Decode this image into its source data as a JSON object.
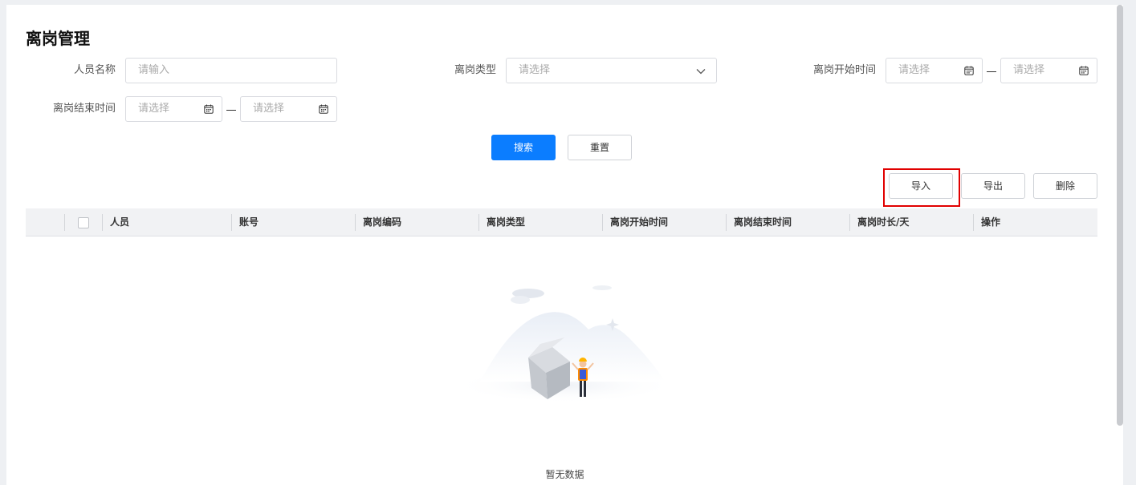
{
  "page": {
    "title": "离岗管理"
  },
  "filters": {
    "name_label": "人员名称",
    "name_placeholder": "请输入",
    "type_label": "离岗类型",
    "type_placeholder": "请选择",
    "start_label": "离岗开始时间",
    "start_from_placeholder": "请选择",
    "start_to_placeholder": "请选择",
    "end_label": "离岗结束时间",
    "end_from_placeholder": "请选择",
    "end_to_placeholder": "请选择",
    "separator": "—"
  },
  "actions": {
    "search": "搜索",
    "reset": "重置",
    "import": "导入",
    "export": "导出",
    "delete": "删除"
  },
  "table": {
    "columns": [
      "人员",
      "账号",
      "离岗编码",
      "离岗类型",
      "离岗开始时间",
      "离岗结束时间",
      "离岗时长/天",
      "操作"
    ],
    "empty_text": "暂无数据"
  },
  "colors": {
    "primary": "#0b7dff",
    "highlight": "#e10000"
  },
  "icons": {
    "calendar": "calendar-icon",
    "dropdown": "chevron-down-icon",
    "empty": "empty-state-illustration"
  }
}
